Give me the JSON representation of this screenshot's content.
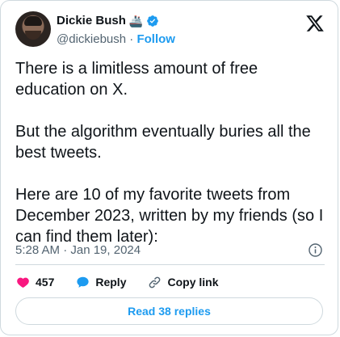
{
  "author": {
    "display_name": "Dickie Bush",
    "emoji": "🚢",
    "handle": "@dickiebush",
    "separator": "·",
    "follow_label": "Follow"
  },
  "tweet": {
    "text": "There is a limitless amount of free education on X.\n\nBut the algorithm eventually buries all the best tweets.\n\nHere are 10 of my favorite tweets from December 2023, written by my friends (so I can find them later):",
    "timestamp": "5:28 AM · Jan 19, 2024"
  },
  "actions": {
    "like_count": "457",
    "reply_label": "Reply",
    "copy_link_label": "Copy link"
  },
  "footer": {
    "read_replies_label": "Read 38 replies"
  },
  "colors": {
    "accent": "#1d9bf0",
    "like": "#f91880",
    "muted": "#536471",
    "border": "#cfd9de"
  },
  "icons": [
    "verified-badge-icon",
    "x-logo-icon",
    "info-icon",
    "heart-icon",
    "reply-bubble-icon",
    "link-icon"
  ]
}
